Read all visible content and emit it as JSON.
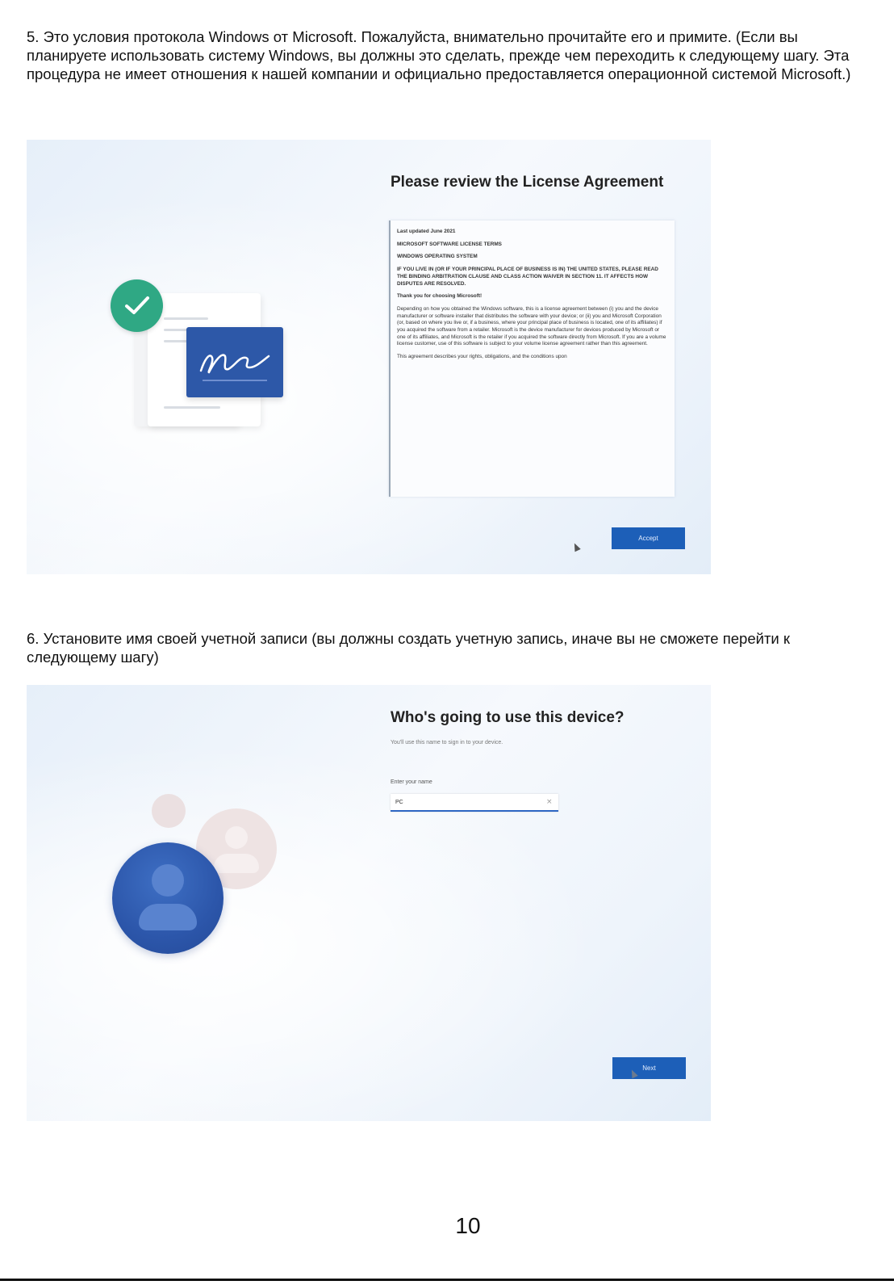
{
  "step5": {
    "text": "5. Это условия протокола Windows от Microsoft. Пожалуйста, внимательно прочитайте его и примите. (Если вы планируете использовать систему Windows, вы должны это сделать, прежде чем переходить к следующему шагу. Эта процедура не имеет отношения к нашей компании и официально предоставляется операционной системой Microsoft.)"
  },
  "screen1": {
    "title": "Please review the License Agreement",
    "license": {
      "updated": "Last updated June 2021",
      "heading1": "MICROSOFT SOFTWARE LICENSE TERMS",
      "heading2": "WINDOWS OPERATING SYSTEM",
      "notice": "IF YOU LIVE IN (OR IF YOUR PRINCIPAL PLACE OF BUSINESS IS IN) THE UNITED STATES, PLEASE READ THE BINDING ARBITRATION CLAUSE AND CLASS ACTION WAIVER IN SECTION 11. IT AFFECTS HOW DISPUTES ARE RESOLVED.",
      "thanks": "Thank you for choosing Microsoft!",
      "body": "Depending on how you obtained the Windows software, this is a license agreement between (i) you and the device manufacturer or software installer that distributes the software with your device; or (ii) you and Microsoft Corporation (or, based on where you live or, if a business, where your principal place of business is located, one of its affiliates) if you acquired the software from a retailer. Microsoft is the device manufacturer for devices produced by Microsoft or one of its affiliates, and Microsoft is the retailer if you acquired the software directly from Microsoft. If you are a volume license customer, use of this software is subject to your volume license agreement rather than this agreement.",
      "tail": "This agreement describes your rights, obligations, and the conditions upon"
    },
    "accept_label": "Accept",
    "sign_text": "ne"
  },
  "step6": {
    "text": "6. Установите имя своей учетной записи (вы должны создать учетную запись, иначе вы не сможете перейти к следующему шагу)"
  },
  "screen2": {
    "title": "Who's going to use this device?",
    "subtitle": "You'll use this name to sign in to your device.",
    "name_label": "Enter your name",
    "name_value": "PC",
    "clear_symbol": "×",
    "next_label": "Next"
  },
  "footer": {
    "page_number": "10"
  },
  "colors": {
    "accent_blue": "#1d5fb8",
    "check_green": "#2fa884",
    "card_blue": "#2d58a8"
  }
}
